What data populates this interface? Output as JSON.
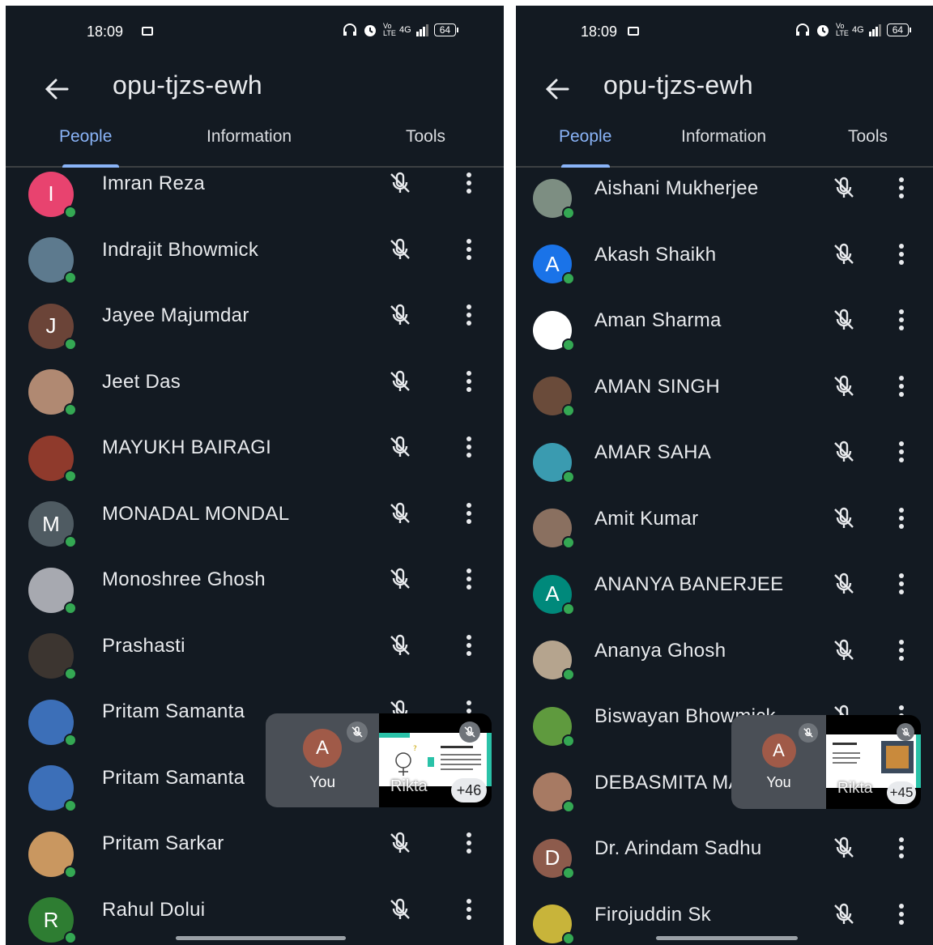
{
  "status": {
    "time": "18:09",
    "network": "4G",
    "volte": "Vo LTE",
    "battery": "64"
  },
  "meeting": {
    "code": "opu-tjzs-ewh"
  },
  "tabs": [
    "People",
    "Information",
    "Tools"
  ],
  "left_list": [
    {
      "name": "Imran Reza",
      "avatar": {
        "initial": "I",
        "color": "#e8436f"
      }
    },
    {
      "name": "Indrajit Bhowmick",
      "avatar": {
        "initial": "",
        "color": "#5d7a8e"
      }
    },
    {
      "name": "Jayee Majumdar",
      "avatar": {
        "initial": "J",
        "color": "#6b4438"
      }
    },
    {
      "name": "Jeet Das",
      "avatar": {
        "initial": "",
        "color": "#b08972"
      }
    },
    {
      "name": "MAYUKH BAIRAGI",
      "avatar": {
        "initial": "",
        "color": "#8f3a2c"
      }
    },
    {
      "name": "MONADAL MONDAL",
      "avatar": {
        "initial": "M",
        "color": "#4f5b62"
      }
    },
    {
      "name": "Monoshree Ghosh",
      "avatar": {
        "initial": "",
        "color": "#a7a9b0"
      }
    },
    {
      "name": "Prashasti",
      "avatar": {
        "initial": "",
        "color": "#3c3530"
      }
    },
    {
      "name": "Pritam Samanta",
      "avatar": {
        "initial": "",
        "color": "#3c6fb8"
      }
    },
    {
      "name": "Pritam Samanta",
      "avatar": {
        "initial": "",
        "color": "#3c6fb8"
      }
    },
    {
      "name": "Pritam Sarkar",
      "avatar": {
        "initial": "",
        "color": "#c99760"
      }
    },
    {
      "name": "Rahul Dolui",
      "avatar": {
        "initial": "R",
        "color": "#2e7d32"
      }
    }
  ],
  "right_list": [
    {
      "name": "Aishani Mukherjee",
      "avatar": {
        "initial": "",
        "color": "#7d8e82"
      }
    },
    {
      "name": "Akash Shaikh",
      "avatar": {
        "initial": "A",
        "color": "#1a73e8"
      }
    },
    {
      "name": "Aman Sharma",
      "avatar": {
        "initial": "",
        "color": "#ffffff"
      }
    },
    {
      "name": "AMAN SINGH",
      "avatar": {
        "initial": "",
        "color": "#6a4b3a"
      }
    },
    {
      "name": "AMAR SAHA",
      "avatar": {
        "initial": "",
        "color": "#3a9bb0"
      }
    },
    {
      "name": "Amit Kumar",
      "avatar": {
        "initial": "",
        "color": "#8a7060"
      }
    },
    {
      "name": "ANANYA BANERJEE",
      "avatar": {
        "initial": "A",
        "color": "#00897b"
      }
    },
    {
      "name": "Ananya Ghosh",
      "avatar": {
        "initial": "",
        "color": "#b5a48e"
      }
    },
    {
      "name": "Biswayan Bhowmick",
      "avatar": {
        "initial": "",
        "color": "#5f9a3e"
      }
    },
    {
      "name": "DEBASMITA MA",
      "avatar": {
        "initial": "",
        "color": "#a77a63"
      }
    },
    {
      "name": "Dr. Arindam Sadhu",
      "avatar": {
        "initial": "D",
        "color": "#8d5b4c"
      }
    },
    {
      "name": "Firojuddin Sk",
      "avatar": {
        "initial": "",
        "color": "#c8b43a"
      }
    }
  ],
  "pip_left": {
    "you_initial": "A",
    "you_label": "You",
    "presenter_label": "Rikta",
    "more_count": "+46"
  },
  "pip_right": {
    "you_initial": "A",
    "you_label": "You",
    "presenter_label": "Rikta",
    "more_count": "+45"
  },
  "colors": {
    "background": "#131a22",
    "accent": "#8ab4f8",
    "online": "#34a853"
  }
}
